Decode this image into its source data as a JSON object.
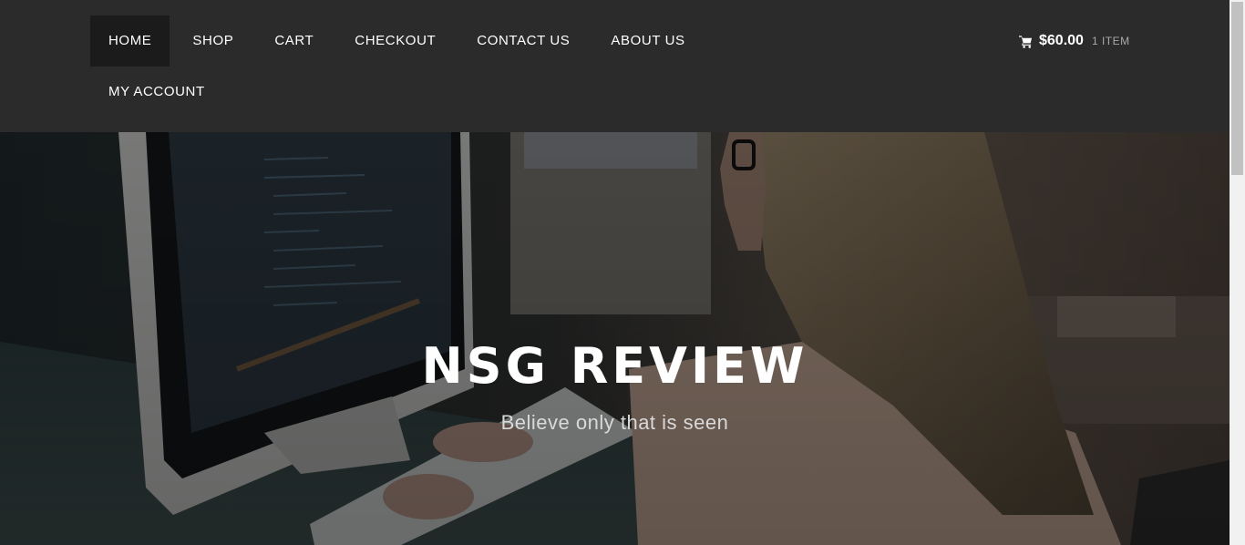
{
  "nav": {
    "items": [
      {
        "label": "HOME",
        "active": true
      },
      {
        "label": "SHOP"
      },
      {
        "label": "CART"
      },
      {
        "label": "CHECKOUT"
      },
      {
        "label": "CONTACT US"
      },
      {
        "label": "ABOUT US"
      },
      {
        "label": "MY ACCOUNT"
      }
    ]
  },
  "cart": {
    "icon": "shopping-cart-icon",
    "total": "$60.00",
    "count": "1 ITEM"
  },
  "hero": {
    "title": "NSG REVIEW",
    "tagline": "Believe only that is seen",
    "image": "woman-typing-at-computer-photo"
  },
  "colors": {
    "header_bg": "#2b2b2b",
    "active_nav_bg": "#1b1b1b",
    "text": "#ffffff"
  }
}
